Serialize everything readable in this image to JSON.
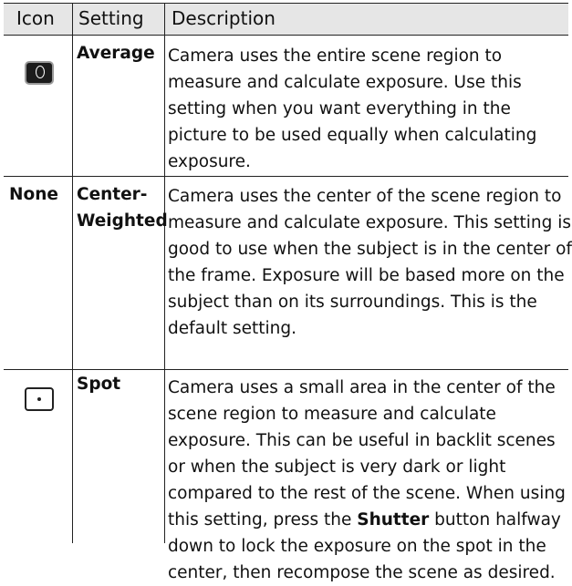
{
  "table": {
    "headers": {
      "icon": "Icon",
      "setting": "Setting",
      "description": "Description"
    },
    "rows": [
      {
        "icon": "average-metering-icon",
        "icon_text": "",
        "setting_lines": [
          "Average"
        ],
        "description_lines": [
          "Camera uses the entire scene region to",
          "measure and calculate exposure. Use this",
          "setting when you want everything in the",
          "picture to be used equally when calculating",
          "exposure."
        ]
      },
      {
        "icon": "",
        "icon_text": "None",
        "setting_lines": [
          "Center-",
          "Weighted"
        ],
        "description_lines": [
          "Camera uses the center of the scene region to",
          "measure and calculate exposure. This setting is",
          "good to use when the subject is in the center of",
          "the frame. Exposure will be based more on the",
          "subject than on its surroundings. This is the",
          "default setting."
        ]
      },
      {
        "icon": "spot-metering-icon",
        "icon_text": "",
        "setting_lines": [
          "Spot"
        ],
        "description_lines": [
          "Camera uses a small area in the center of the",
          "scene region to measure and calculate",
          "exposure. This can be useful in backlit scenes",
          "or when the subject is very dark or light",
          "compared to the rest of the scene. When using",
          "this setting, press the ",
          "down to lock the exposure on the spot in the",
          "center, then recompose the scene as desired."
        ],
        "shutter_word": "Shutter",
        "shutter_tail": " button halfway"
      }
    ]
  }
}
